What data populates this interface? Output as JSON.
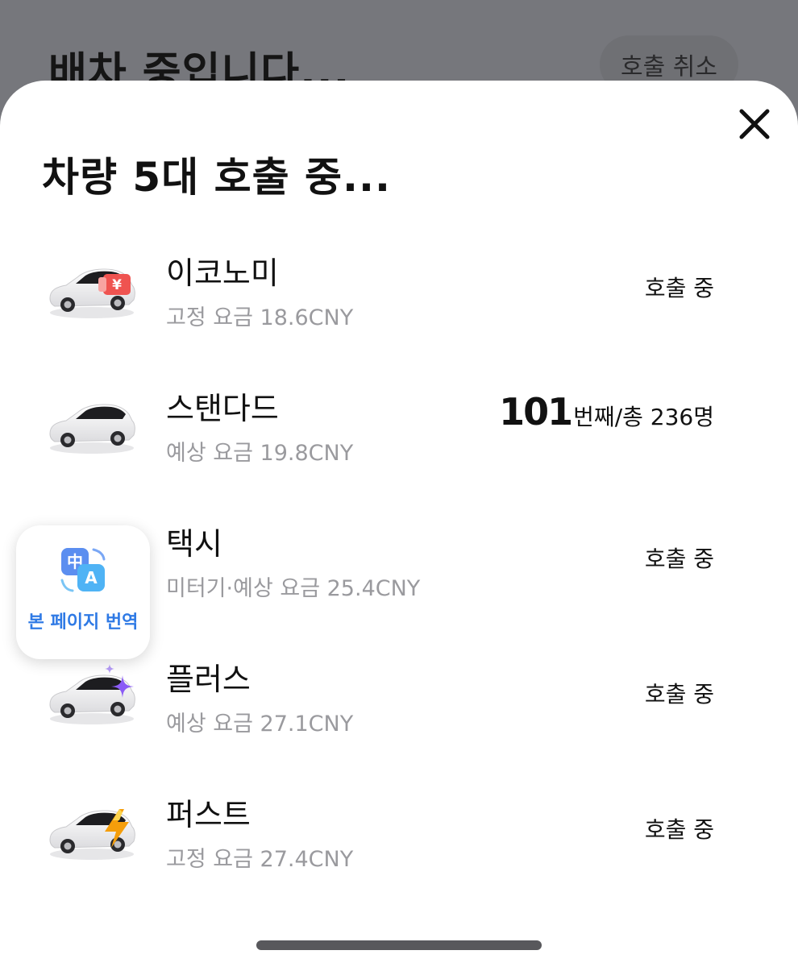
{
  "background": {
    "title": "배차 중입니다...",
    "cancel_label": "호출 취소"
  },
  "sheet": {
    "title": "차량 5대 호출 중...",
    "close_icon": "close-icon"
  },
  "rides": [
    {
      "name": "이코노미",
      "price": "고정 요금 18.6CNY",
      "status": "호출 중",
      "badge": "yen-badge"
    },
    {
      "name": "스탠다드",
      "price": "예상 요금 19.8CNY",
      "queue_position": "101",
      "queue_text": "번째/총 236명"
    },
    {
      "name": "택시",
      "price": "미터기·예상 요금 25.4CNY",
      "status": "호출 중",
      "badge": "none"
    },
    {
      "name": "플러스",
      "price": "예상 요금 27.1CNY",
      "status": "호출 중",
      "badge": "sparkle-badge"
    },
    {
      "name": "퍼스트",
      "price": "고정 요금 27.4CNY",
      "status": "호출 중",
      "badge": "lightning-badge"
    }
  ],
  "translate_widget": {
    "label": "본 페이지 번역",
    "icon": "translate-icon"
  },
  "colors": {
    "accent_blue": "#2f7ae5",
    "muted_text": "#9a9a9e",
    "overlay": "#76777c"
  }
}
